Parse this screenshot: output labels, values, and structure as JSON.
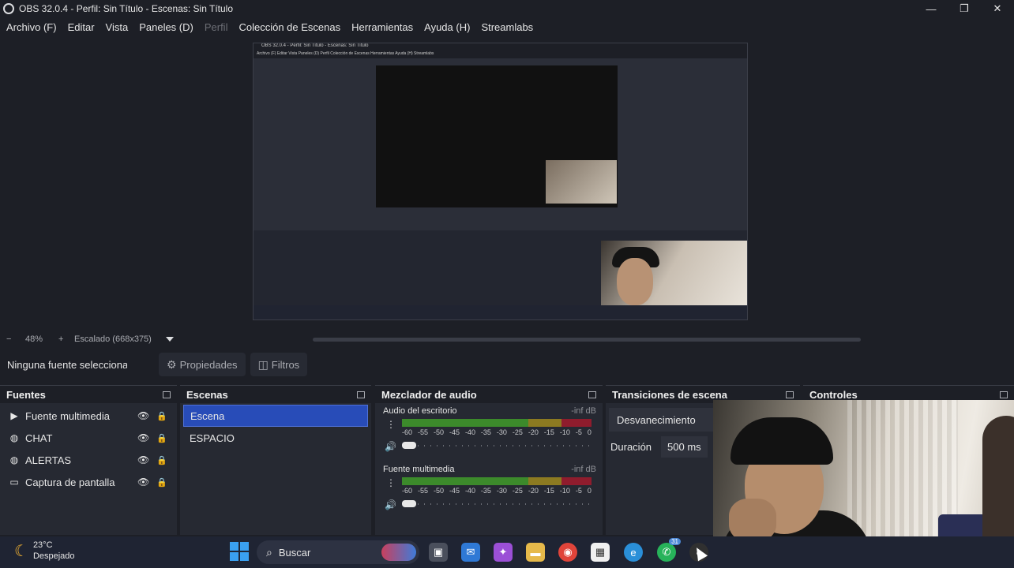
{
  "window": {
    "title": "OBS 32.0.4 - Perfil: Sin Título - Escenas: Sin Título",
    "controls": [
      "—",
      "❐",
      "✕"
    ]
  },
  "menu": [
    {
      "label": "Archivo (F)",
      "enabled": true
    },
    {
      "label": "Editar",
      "enabled": true
    },
    {
      "label": "Vista",
      "enabled": true
    },
    {
      "label": "Paneles (D)",
      "enabled": true
    },
    {
      "label": "Perfil",
      "enabled": false
    },
    {
      "label": "Colección de Escenas",
      "enabled": true
    },
    {
      "label": "Herramientas",
      "enabled": true
    },
    {
      "label": "Ayuda (H)",
      "enabled": true
    },
    {
      "label": "Streamlabs",
      "enabled": true
    }
  ],
  "preview": {
    "mini_title": "OBS 32.0.4 - Perfil: Sin Título - Escenas: Sin Título",
    "mini_menu": "Archivo (F)   Editar   Vista   Paneles (D)   Perfil   Colección de Escenas   Herramientas   Ayuda (H)   Streamlabs"
  },
  "zoom": {
    "minus": "−",
    "level": "48%",
    "plus": "+",
    "scale_label": "Escalado (668x375)"
  },
  "source_bar": {
    "no_source": "Ninguna fuente seleccionada",
    "properties": "Propiedades",
    "filters": "Filtros"
  },
  "docks": {
    "sources": {
      "title": "Fuentes",
      "items": [
        {
          "label": "Fuente multimedia",
          "icon": "play-icon"
        },
        {
          "label": "CHAT",
          "icon": "globe-icon"
        },
        {
          "label": "ALERTAS",
          "icon": "globe-icon"
        },
        {
          "label": "Captura de pantalla",
          "icon": "monitor-icon"
        }
      ]
    },
    "scenes": {
      "title": "Escenas",
      "items": [
        "Escena",
        "ESPACIO"
      ],
      "active_index": 0
    },
    "mixer": {
      "title": "Mezclador de audio",
      "ticks": [
        "-60",
        "-55",
        "-50",
        "-45",
        "-40",
        "-35",
        "-30",
        "-25",
        "-20",
        "-15",
        "-10",
        "-5",
        "0"
      ],
      "channels": [
        {
          "name": "Audio del escritorio",
          "db": "-inf dB"
        },
        {
          "name": "Fuente multimedia",
          "db": "-inf dB"
        }
      ]
    },
    "transitions": {
      "title": "Transiciones de escena",
      "type": "Desvanecimiento",
      "duration_label": "Duración",
      "duration_value": "500 ms"
    },
    "controls": {
      "title": "Controles"
    }
  },
  "taskbar": {
    "temperature": "23°C",
    "condition": "Despejado",
    "search_placeholder": "Buscar",
    "whatsapp_badge": "31",
    "colors": {
      "taskbar_bg": "#1f2433",
      "accent": "#284cb8"
    }
  }
}
